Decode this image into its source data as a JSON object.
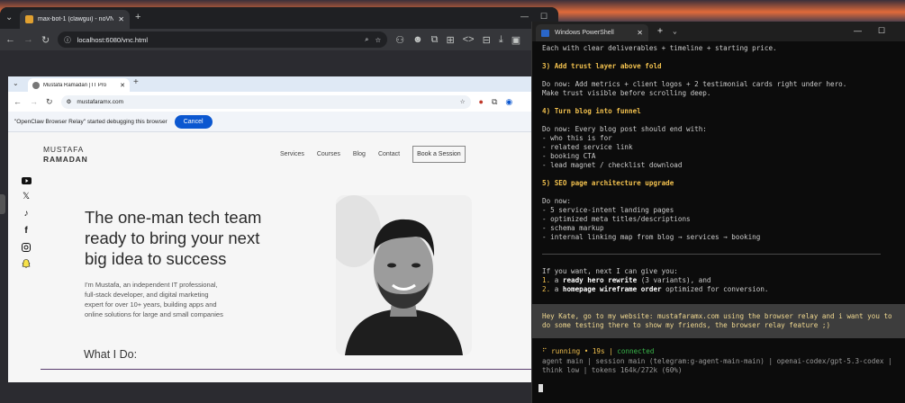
{
  "outer_browser": {
    "tab_title": "max-bot-1 (clawgui) - noVNC",
    "url": "localhost:6080/vnc.html"
  },
  "inner_browser": {
    "tab_title": "Mustafa Ramadan | IT Pro",
    "url": "mustafaramx.com",
    "debug_message": "\"OpenClaw Browser Relay\" started debugging this browser",
    "cancel_label": "Cancel"
  },
  "website": {
    "logo_line1": "MUSTAFA",
    "logo_line2": "RAMADAN",
    "nav": [
      "Services",
      "Courses",
      "Blog",
      "Contact"
    ],
    "book_label": "Book a Session",
    "hero_lines": [
      "The one-man tech team",
      "ready to bring your next",
      "big idea to success"
    ],
    "intro_lines": [
      "I'm Mustafa, an independent IT professional,",
      "full-stack developer, and digital marketing",
      "expert for over 10+ years, building apps and",
      "online solutions for large and small companies"
    ],
    "what_i_do": "What I Do:"
  },
  "terminal": {
    "tab_title": "Windows PowerShell",
    "lines": {
      "l0": "Each with clear deliverables + timeline + starting price.",
      "h3": "3) Add trust layer above fold",
      "l3a": "Do now: Add metrics + client logos + 2 testimonial cards right under hero.",
      "l3b": "Make trust visible before scrolling deep.",
      "h4": "4) Turn blog into funnel",
      "l4a": "Do now: Every blog post should end with:",
      "l4b": "- who this is for",
      "l4c": "- related service link",
      "l4d": "- booking CTA",
      "l4e": "- lead magnet / checklist download",
      "h5": "5) SEO page architecture upgrade",
      "l5a": "Do now:",
      "l5b": "- 5 service-intent landing pages",
      "l5c": "- optimized meta titles/descriptions",
      "l5d": "- schema markup",
      "l5e": "- internal linking map from blog → services → booking",
      "offer": "If you want, next I can give you:",
      "o1num": "1.",
      "o1pre": " a ",
      "o1bold": "ready hero rewrite",
      "o1post": " (3 variants), and",
      "o2num": "2.",
      "o2pre": " a ",
      "o2bold": "homepage wireframe order",
      "o2post": " optimized for conversion."
    },
    "user_prompt_1": "Hey Kate, go to my website: mustafaramx.com using the browser relay and i want you to",
    "user_prompt_2": "do some testing there to show my friends, the browser relay feature ;)",
    "status_spinner": "⠋",
    "status_running": " running • 19s | ",
    "status_connected": "connected",
    "footer_1": "agent main | session main (telegram:g-agent-main-main) | openai-codex/gpt-5.3-codex |",
    "footer_2": "think low | tokens 164k/272k (60%)"
  },
  "colors": {
    "accent_cancel": "#0b57d0",
    "terminal_heading": "#f2c14e",
    "terminal_status_ok": "#39b54a"
  }
}
